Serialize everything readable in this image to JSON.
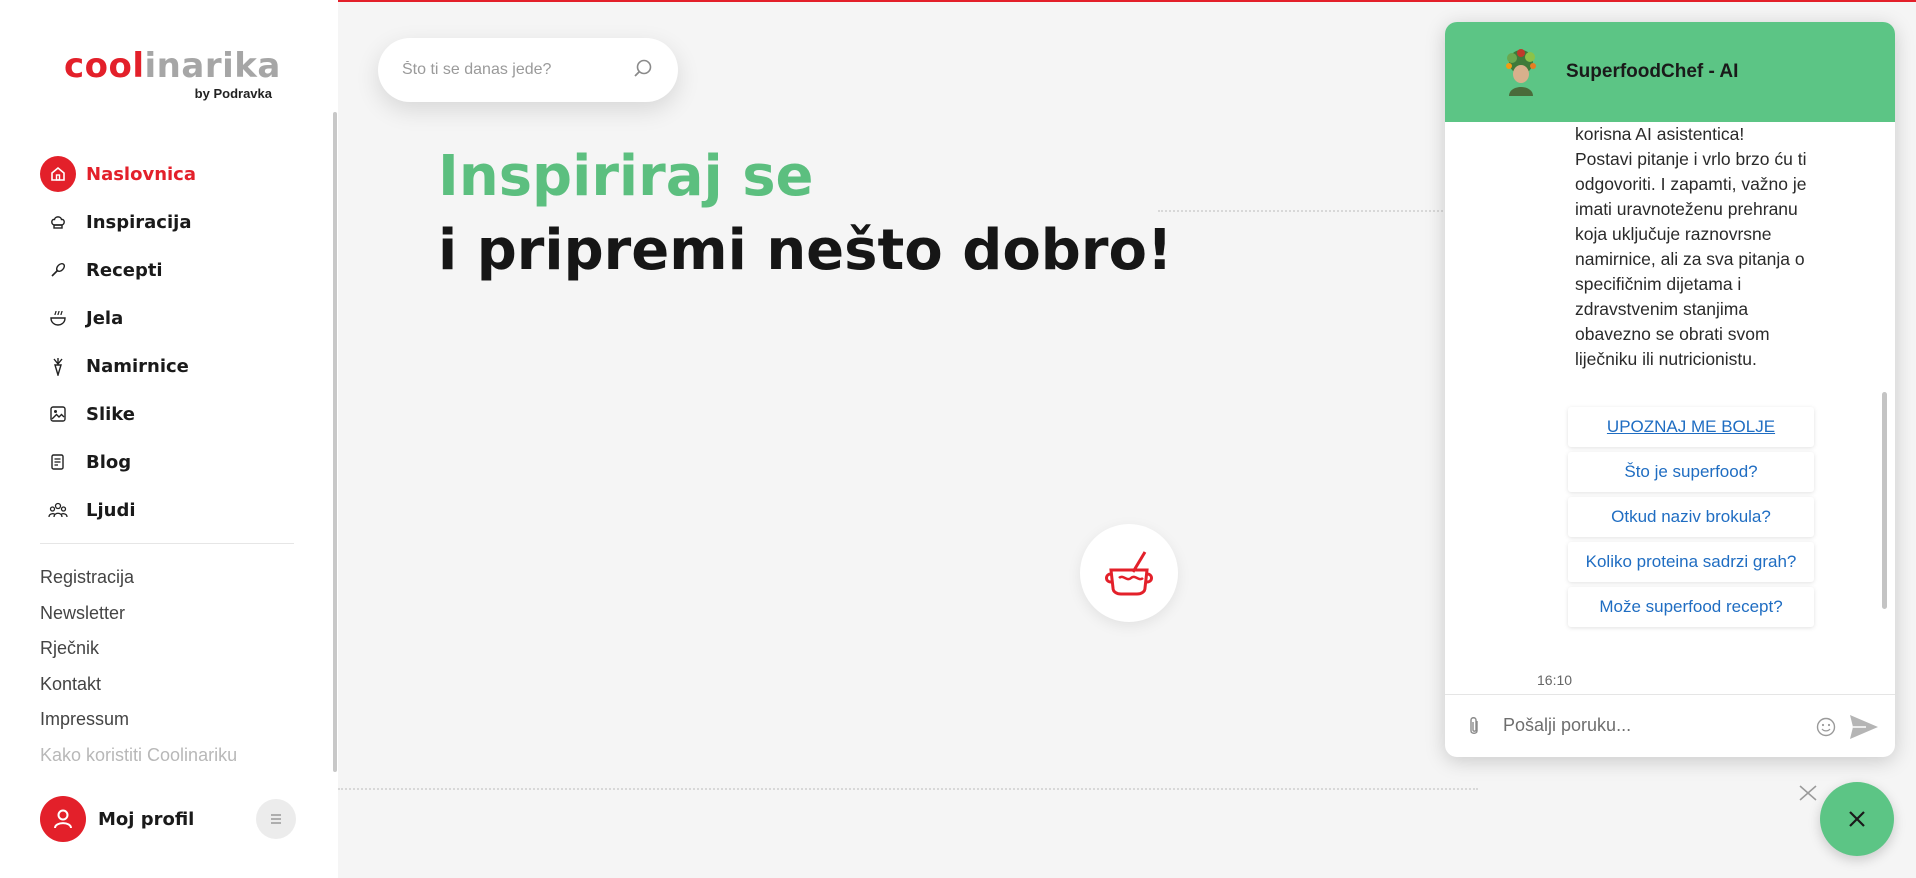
{
  "logo": {
    "main_red": "cool",
    "main_grey": "inarika",
    "sub": "by Podravka"
  },
  "nav": {
    "items": [
      {
        "label": "Naslovnica",
        "icon": "home-icon",
        "active": true
      },
      {
        "label": "Inspiracija",
        "icon": "chef-hat-icon",
        "active": false
      },
      {
        "label": "Recepti",
        "icon": "whisk-icon",
        "active": false
      },
      {
        "label": "Jela",
        "icon": "dish-icon",
        "active": false
      },
      {
        "label": "Namirnice",
        "icon": "vegetable-icon",
        "active": false
      },
      {
        "label": "Slike",
        "icon": "image-icon",
        "active": false
      },
      {
        "label": "Blog",
        "icon": "blog-icon",
        "active": false
      },
      {
        "label": "Ljudi",
        "icon": "people-icon",
        "active": false
      }
    ]
  },
  "links": [
    "Registracija",
    "Newsletter",
    "Rječnik",
    "Kontakt",
    "Impressum",
    "Kako koristiti Coolinariku"
  ],
  "profile": {
    "label": "Moj profil"
  },
  "search": {
    "placeholder": "Što ti se danas jede?"
  },
  "hero": {
    "line1": "Inspiriraj se",
    "line2": "i pripremi nešto dobro!"
  },
  "chat": {
    "title": "SuperfoodChef - AI",
    "message_lines": [
      "korisna AI asistentica!",
      "Postavi pitanje i vrlo brzo ću ti",
      "odgovoriti. I zapamti, važno je",
      "imati uravnoteženu prehranu",
      "koja uključuje raznovrsne",
      "namirnice, ali za sva pitanja o",
      "specifičnim dijetama i",
      "zdravstvenim stanjima",
      "obavezno se obrati svom",
      "liječniku ili nutricionistu."
    ],
    "quick_replies": [
      "UPOZNAJ ME BOLJE",
      "Što je superfood?",
      "Otkud naziv brokula?",
      "Koliko proteina sadrzi grah?",
      "Može superfood recept?"
    ],
    "time": "16:10",
    "input_placeholder": "Pošalji poruku..."
  },
  "colors": {
    "brand_red": "#e3202a",
    "brand_green": "#5cc585",
    "link_blue": "#1f6dc2"
  }
}
